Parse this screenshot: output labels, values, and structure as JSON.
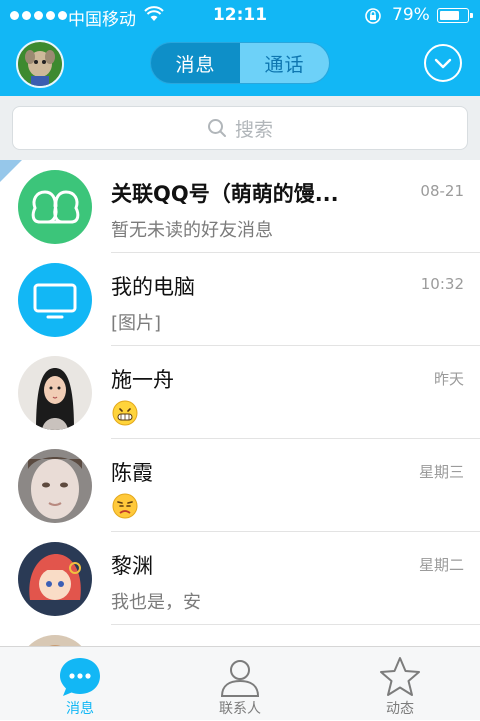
{
  "status_bar": {
    "carrier": "中国移动",
    "time": "12:11",
    "battery_percent": "79%",
    "battery_level": 0.79
  },
  "header": {
    "tabs": [
      {
        "label": "消息",
        "active": true
      },
      {
        "label": "通话",
        "active": false
      }
    ]
  },
  "search": {
    "placeholder": "搜索"
  },
  "conversations": [
    {
      "name": "关联QQ号（萌萌的馒...",
      "time": "08-21",
      "message": "暂无未读的好友消息",
      "avatar": "linked-qq-icon"
    },
    {
      "name": "我的电脑",
      "time": "10:32",
      "message": "[图片]",
      "avatar": "computer-icon"
    },
    {
      "name": "施一舟",
      "time": "昨天",
      "message": "",
      "avatar": "photo",
      "emoji": "grin-emoji"
    },
    {
      "name": "陈霞",
      "time": "星期三",
      "message": "",
      "avatar": "photo",
      "emoji": "annoyed-emoji"
    },
    {
      "name": "黎渊",
      "time": "星期二",
      "message": "我也是，安",
      "avatar": "photo"
    }
  ],
  "tabbar": {
    "items": [
      {
        "label": "消息",
        "icon": "chat-bubble-icon",
        "active": true
      },
      {
        "label": "联系人",
        "icon": "person-icon",
        "active": false
      },
      {
        "label": "动态",
        "icon": "star-icon",
        "active": false
      }
    ]
  },
  "colors": {
    "accent": "#12b7f5",
    "active_tab": "#0e8fc8"
  }
}
